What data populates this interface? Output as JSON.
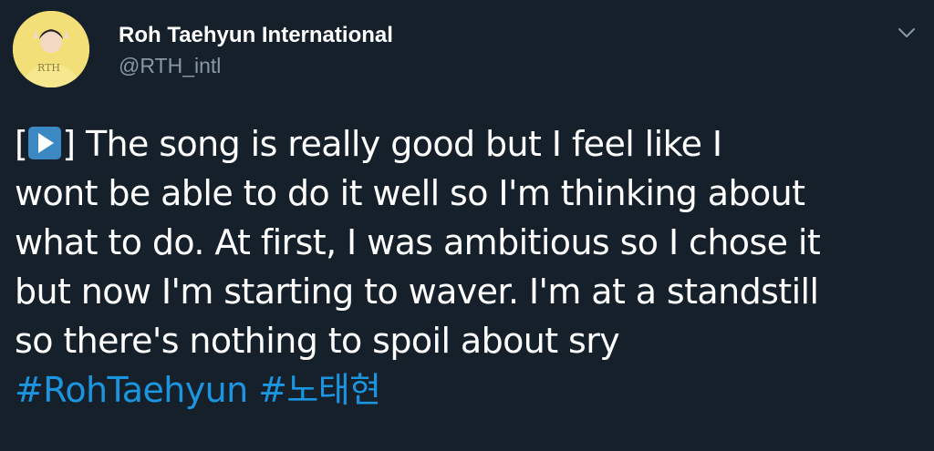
{
  "author": {
    "display_name": "Roh Taehyun International",
    "handle": "@RTH_intl",
    "avatar_text": "RTH"
  },
  "tweet": {
    "open_bracket": "[",
    "emoji": "play-button-emoji",
    "line1_rest": "] The song is really good but I feel like I",
    "line2": "wont be able to do it well so I'm thinking about",
    "line3": "what to do. At first, I was ambitious so I chose it",
    "line4": "but now I'm starting to waver. I'm at a standstill",
    "line5": "so there's nothing to spoil about sry",
    "hashtags": [
      "#RohTaehyun",
      "#노태현"
    ]
  },
  "icons": {
    "menu": "chevron-down-icon"
  },
  "colors": {
    "background": "#15202b",
    "text": "#ffffff",
    "secondary": "#8899a6",
    "link": "#1b95e0",
    "emoji_bg": "#3b88c3"
  }
}
